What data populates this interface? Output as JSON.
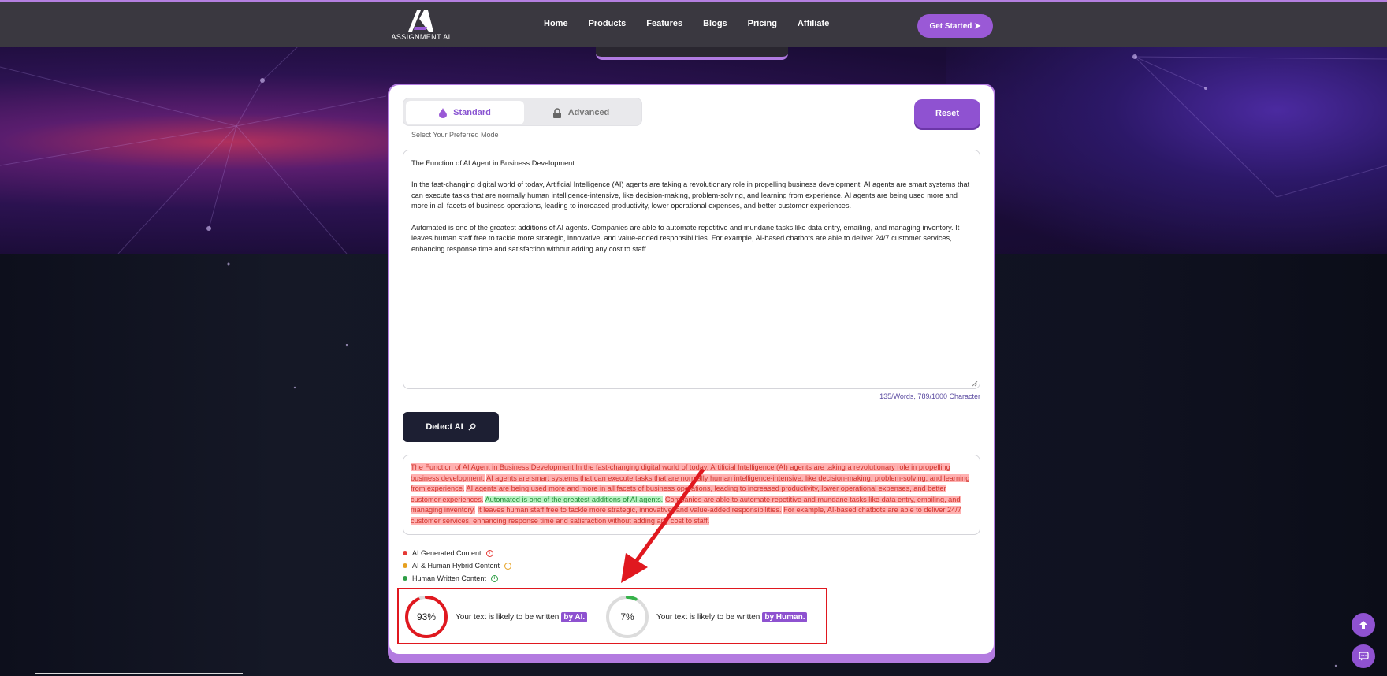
{
  "brand": {
    "name": "ASSIGNMENT AI"
  },
  "nav": {
    "links": [
      "Home",
      "Products",
      "Features",
      "Blogs",
      "Pricing",
      "Affiliate"
    ],
    "cta": "Get Started ➤"
  },
  "detector": {
    "modes": {
      "standard": "Standard",
      "advanced": "Advanced",
      "hint": "Select Your Preferred Mode"
    },
    "reset_label": "Reset",
    "input": {
      "title": "The Function of AI Agent in Business Development",
      "para1": "In the fast-changing digital world of today, Artificial Intelligence (AI) agents are taking a revolutionary role in propelling business development. AI agents are smart systems that can execute tasks that are normally human intelligence-intensive, like decision-making, problem-solving, and learning from experience. AI agents are being used more and more in all facets of business operations, leading to increased productivity, lower operational expenses, and better customer experiences.",
      "para2": "Automated is one of the greatest additions of AI agents. Companies are able to automate repetitive and mundane tasks like data entry, emailing, and managing inventory. It leaves human staff free to tackle more strategic, innovative, and value-added responsibilities. For example, AI-based chatbots are able to deliver 24/7 customer services, enhancing response time and satisfaction without adding any cost to staff."
    },
    "count_label": "135/Words, 789/1000 Character",
    "detect_label": "Detect AI",
    "result_segments": [
      {
        "type": "ai",
        "text": "The Function of AI Agent in Business Development In the fast-changing digital world of today, Artificial Intelligence (AI) agents are taking a revolutionary role in propelling business development."
      },
      {
        "type": "ai",
        "text": "AI agents are smart systems that can execute tasks that are normally human intelligence-intensive, like decision-making, problem-solving, and learning from experience."
      },
      {
        "type": "ai",
        "text": "AI agents are being used more and more in all facets of business operations, leading to increased productivity, lower operational expenses, and better customer experiences."
      },
      {
        "type": "human",
        "text": "Automated is one of the greatest additions of AI agents."
      },
      {
        "type": "ai",
        "text": "Companies are able to automate repetitive and mundane tasks like data entry, emailing, and managing inventory."
      },
      {
        "type": "ai",
        "text": "It leaves human staff free to tackle more strategic, innovative, and value-added responsibilities."
      },
      {
        "type": "ai",
        "text": "For example, AI-based chatbots are able to deliver 24/7 customer services, enhancing response time and satisfaction without adding any cost to staff."
      }
    ],
    "legend": [
      {
        "label": "AI Generated Content",
        "color": "#e53935"
      },
      {
        "label": "AI & Human Hybrid Content",
        "color": "#e6a020"
      },
      {
        "label": "Human Written Content",
        "color": "#2e9e45"
      }
    ],
    "scores": {
      "ai": {
        "value": 0.93,
        "label": "93%",
        "text": "Your text is likely to be written",
        "tag": "by AI.",
        "color": "#e0181f"
      },
      "human": {
        "value": 0.07,
        "label": "7%",
        "text": "Your text is likely to be written",
        "tag": "by Human.",
        "color": "#36b24a"
      }
    }
  },
  "colors": {
    "accent": "#8f52d1",
    "nav_bg": "#3a3840",
    "annotation": "#e0181f"
  }
}
